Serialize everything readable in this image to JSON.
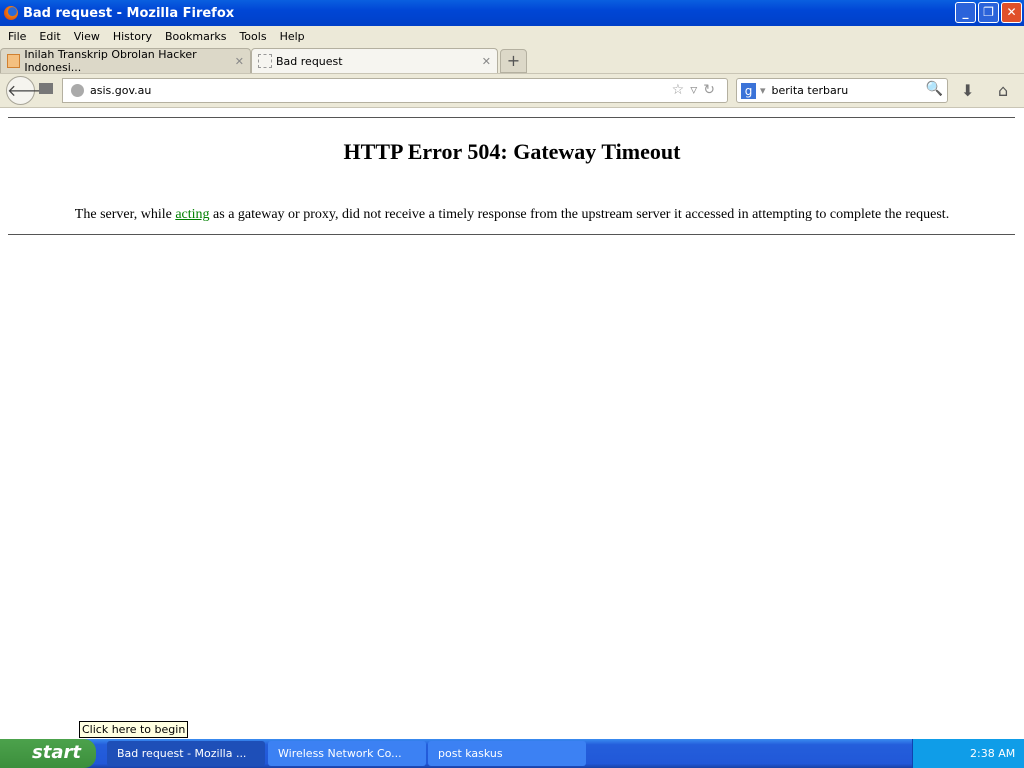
{
  "window": {
    "title": "Bad request - Mozilla Firefox"
  },
  "menu": [
    "File",
    "Edit",
    "View",
    "History",
    "Bookmarks",
    "Tools",
    "Help"
  ],
  "tabs": [
    {
      "label": "Inilah Transkrip Obrolan Hacker Indonesi..."
    },
    {
      "label": "Bad request"
    }
  ],
  "nav": {
    "url": "asis.gov.au",
    "search_value": "berita terbaru"
  },
  "page": {
    "heading": "HTTP Error 504: Gateway Timeout",
    "msg_before": "The server, while ",
    "link": "acting",
    "msg_after": " as a gateway or proxy, did not receive a timely response from the upstream server it accessed in attempting to complete the request."
  },
  "tooltip": "Click here to begin",
  "taskbar": {
    "start": "start",
    "tasks": [
      "Bad request - Mozilla ...",
      "Wireless Network Co...",
      "post kaskus"
    ],
    "clock": "2:38 AM"
  }
}
